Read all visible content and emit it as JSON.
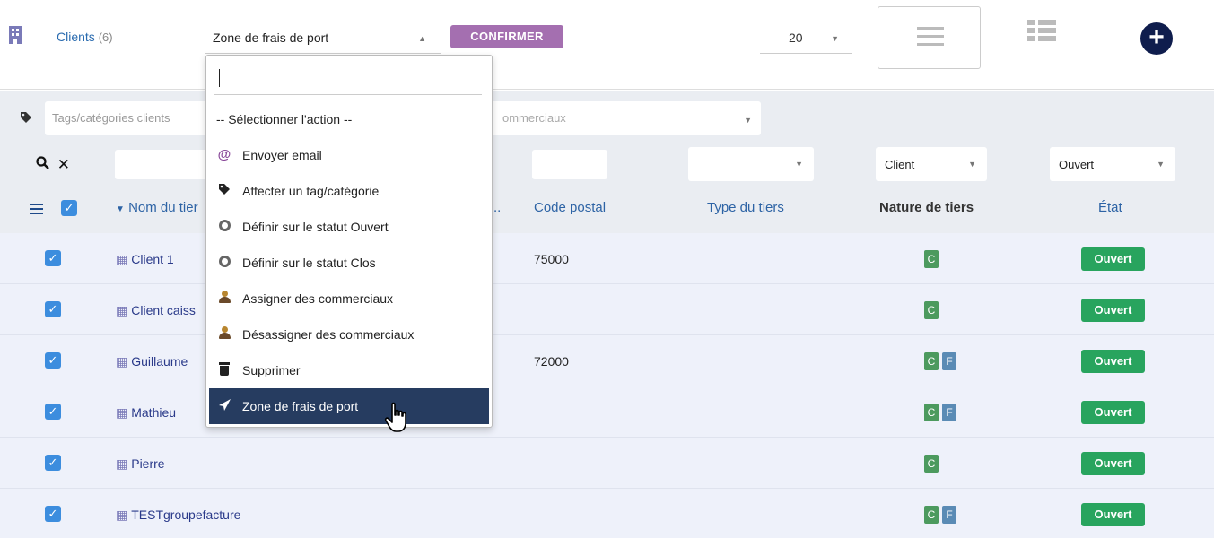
{
  "header": {
    "title": "Clients",
    "count": "(6)",
    "mass_action_value": "Zone de frais de port",
    "confirm_label": "CONFIRMER",
    "per_page": "20"
  },
  "filters": {
    "tags_placeholder": "Tags/catégories clients",
    "sales_placeholder": "ommerciaux",
    "nature_value": "Client",
    "status_value": "Ouvert"
  },
  "columns": {
    "name": "Nom du tier",
    "truncated": "..",
    "zip": "Code postal",
    "type": "Type du tiers",
    "nature": "Nature de tiers",
    "status": "État"
  },
  "dropdown": {
    "items": [
      {
        "label": "-- Sélectionner l'action --",
        "icon": "none"
      },
      {
        "label": "Envoyer email",
        "icon": "at-icon"
      },
      {
        "label": "Affecter un tag/catégorie",
        "icon": "tag-icon"
      },
      {
        "label": "Définir sur le statut Ouvert",
        "icon": "circle-ring-icon"
      },
      {
        "label": "Définir sur le statut Clos",
        "icon": "circle-ring-icon"
      },
      {
        "label": "Assigner des commerciaux",
        "icon": "user-icon"
      },
      {
        "label": "Désassigner des commerciaux",
        "icon": "user-icon"
      },
      {
        "label": "Supprimer",
        "icon": "trash-icon"
      },
      {
        "label": "Zone de frais de port",
        "icon": "paper-plane-icon"
      }
    ]
  },
  "rows": [
    {
      "name": "Client 1",
      "zip": "75000",
      "badges": [
        "C"
      ],
      "status": "Ouvert"
    },
    {
      "name": "Client caiss",
      "zip": "",
      "badges": [
        "C"
      ],
      "status": "Ouvert"
    },
    {
      "name": "Guillaume",
      "zip": "72000",
      "badges": [
        "C",
        "F"
      ],
      "status": "Ouvert"
    },
    {
      "name": "Mathieu",
      "zip": "",
      "badges": [
        "C",
        "F"
      ],
      "status": "Ouvert"
    },
    {
      "name": "Pierre",
      "zip": "",
      "badges": [
        "C"
      ],
      "status": "Ouvert"
    },
    {
      "name": "TESTgroupefacture",
      "zip": "",
      "badges": [
        "C",
        "F"
      ],
      "status": "Ouvert"
    }
  ],
  "colors": {
    "accent": "#a46fb0",
    "selected_menu": "#263c60",
    "status_open": "#28a45e",
    "badge_client": "#4c9a5e",
    "badge_supplier": "#5a8bb5"
  }
}
